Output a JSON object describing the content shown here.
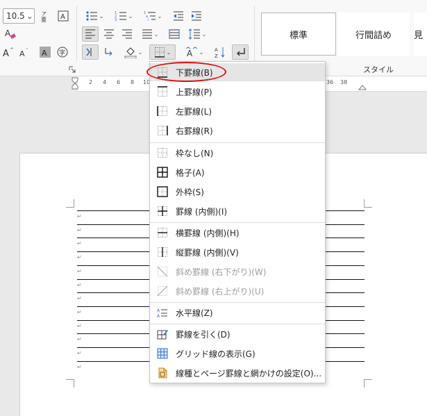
{
  "ribbon": {
    "font_size": "10.5",
    "styles": {
      "standard": "標準",
      "compact": "行間詰め",
      "more_partial": "見"
    },
    "style_group_label": "スタイル"
  },
  "ruler": {
    "left_numbers": [
      "2",
      "4",
      "6",
      "8",
      "10"
    ],
    "right_numbers": [
      "38"
    ],
    "right_partial": "36"
  },
  "menu": {
    "items": [
      {
        "id": "bottom",
        "label": "下罫線(B)"
      },
      {
        "id": "top",
        "label": "上罫線(P)"
      },
      {
        "id": "left",
        "label": "左罫線(L)"
      },
      {
        "id": "right",
        "label": "右罫線(R)"
      },
      {
        "id": "none",
        "label": "枠なし(N)"
      },
      {
        "id": "all",
        "label": "格子(A)"
      },
      {
        "id": "outside",
        "label": "外枠(S)"
      },
      {
        "id": "inside",
        "label": "罫線 (内側)(I)"
      },
      {
        "id": "inside-h",
        "label": "横罫線 (内側)(H)"
      },
      {
        "id": "inside-v",
        "label": "縦罫線 (内側)(V)"
      },
      {
        "id": "diag-down",
        "label": "斜め罫線 (右下がり)(W)"
      },
      {
        "id": "diag-up",
        "label": "斜め罫線 (右上がり)(U)"
      },
      {
        "id": "horizontal-line",
        "label": "水平線(Z)"
      },
      {
        "id": "draw-table",
        "label": "罫線を引く(D)"
      },
      {
        "id": "view-gridlines",
        "label": "グリッド線の表示(G)"
      },
      {
        "id": "borders-shading",
        "label": "線種とページ罫線と網かけの設定(O)..."
      }
    ]
  },
  "document": {
    "paragraph_mark": "↵"
  }
}
